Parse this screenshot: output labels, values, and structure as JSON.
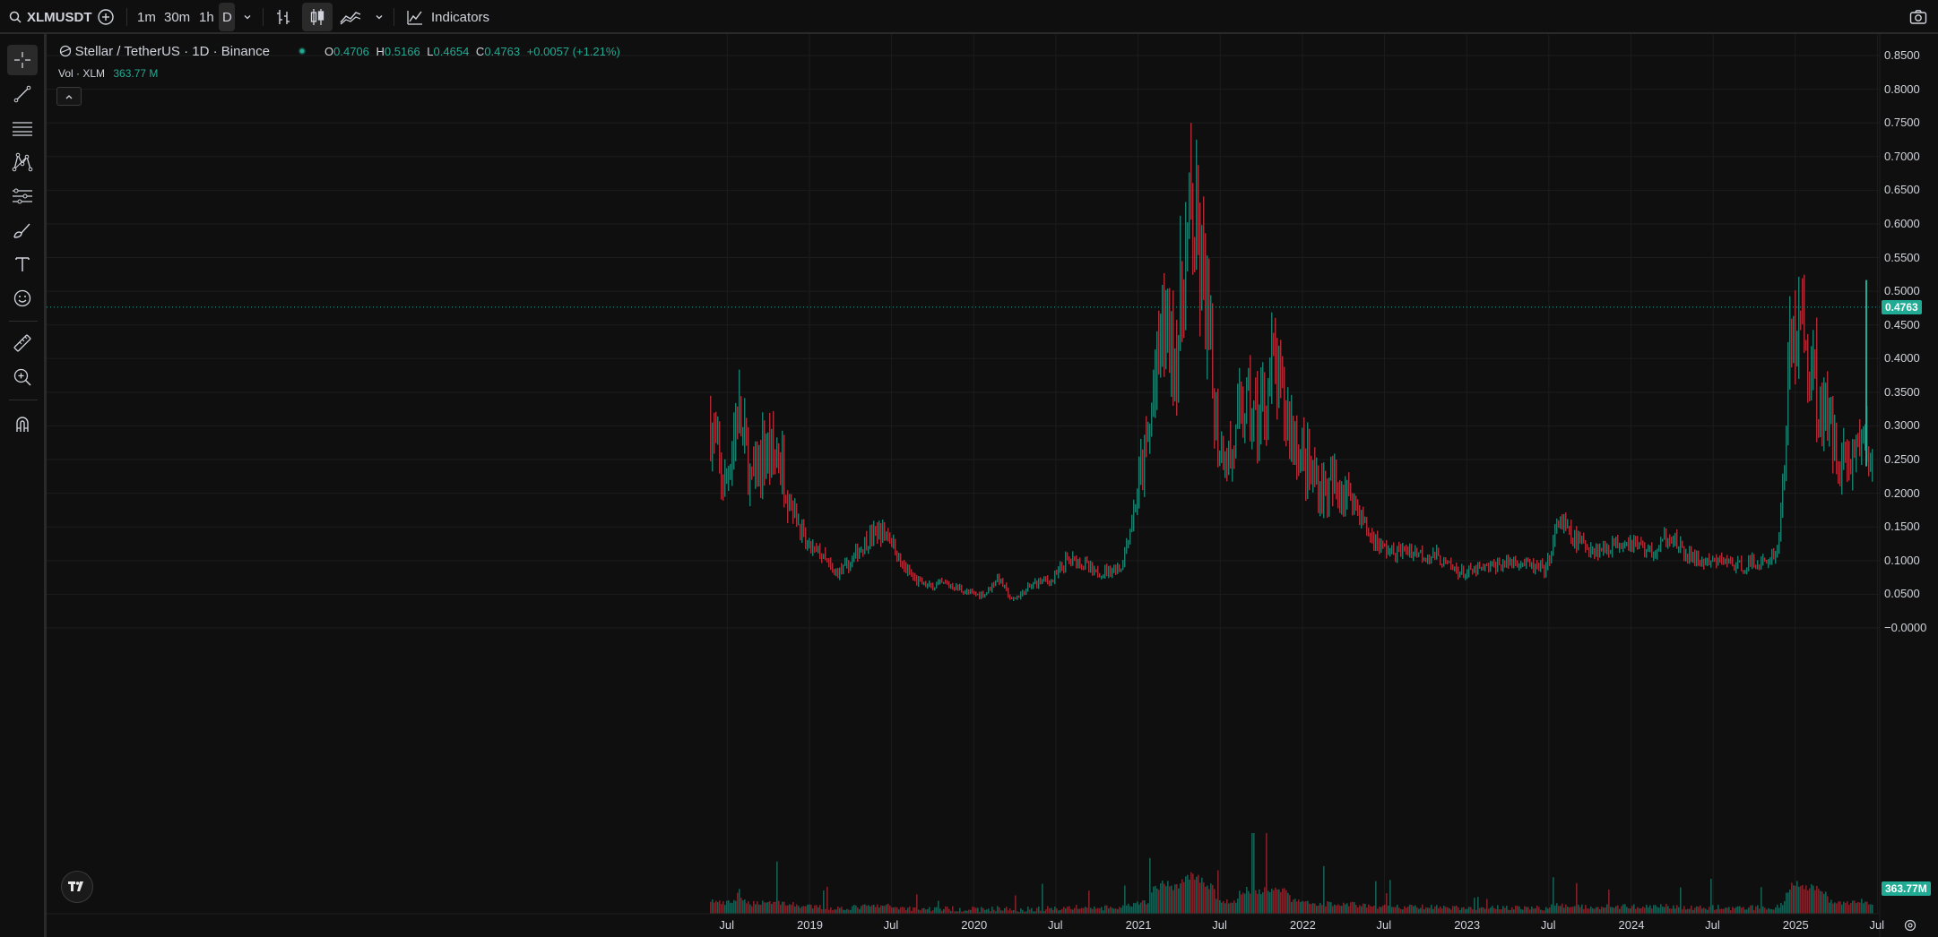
{
  "toolbar": {
    "symbol": "XLMUSDT",
    "intervals": [
      "1m",
      "30m",
      "1h",
      "D"
    ],
    "indicators_label": "Indicators"
  },
  "legend": {
    "title": "Stellar / TetherUS · 1D · Binance",
    "ohlc": [
      {
        "label": "O",
        "value": "0.4706"
      },
      {
        "label": "H",
        "value": "0.5166"
      },
      {
        "label": "L",
        "value": "0.4654"
      },
      {
        "label": "C",
        "value": "0.4763"
      }
    ],
    "change": "+0.0057 (+1.21%)",
    "volume_label": "Vol · XLM",
    "volume_value": "363.77 M",
    "status_color": "#22ab94"
  },
  "colors": {
    "up": "#22ab94",
    "down": "#f23645",
    "background": "#0f0f0f"
  },
  "price_axis": {
    "ticks": [
      "0.8500",
      "0.8000",
      "0.7500",
      "0.7000",
      "0.6500",
      "0.6000",
      "0.5500",
      "0.5000",
      "0.4500",
      "0.4000",
      "0.3500",
      "0.3000",
      "0.2500",
      "0.2000",
      "0.1500",
      "0.1000",
      "0.0500",
      "−0.0000"
    ],
    "last_price": "0.4763",
    "last_volume": "363.77M"
  },
  "time_axis": {
    "ticks": [
      "Jul",
      "2019",
      "Jul",
      "2020",
      "Jul",
      "2021",
      "Jul",
      "2022",
      "Jul",
      "2023",
      "Jul",
      "2024",
      "Jul",
      "2025",
      "Jul"
    ]
  },
  "chart_data": {
    "type": "candlestick",
    "interval": "1D",
    "x_range": [
      "2018-05",
      "2025-07"
    ],
    "ylim": [
      -0.02,
      0.87
    ],
    "grid": true,
    "last_close": 0.4763,
    "price_path": [
      [
        "2018-05",
        0.3
      ],
      [
        "2018-06",
        0.2
      ],
      [
        "2018-07",
        0.32
      ],
      [
        "2018-08",
        0.21
      ],
      [
        "2018-09",
        0.26
      ],
      [
        "2018-10",
        0.25
      ],
      [
        "2018-11",
        0.18
      ],
      [
        "2018-12",
        0.12
      ],
      [
        "2019-01",
        0.11
      ],
      [
        "2019-02",
        0.08
      ],
      [
        "2019-03",
        0.09
      ],
      [
        "2019-04",
        0.12
      ],
      [
        "2019-05",
        0.14
      ],
      [
        "2019-06",
        0.14
      ],
      [
        "2019-07",
        0.09
      ],
      [
        "2019-08",
        0.07
      ],
      [
        "2019-09",
        0.06
      ],
      [
        "2019-10",
        0.065
      ],
      [
        "2019-11",
        0.06
      ],
      [
        "2019-12",
        0.05
      ],
      [
        "2020-01",
        0.05
      ],
      [
        "2020-02",
        0.075
      ],
      [
        "2020-03",
        0.04
      ],
      [
        "2020-04",
        0.055
      ],
      [
        "2020-05",
        0.07
      ],
      [
        "2020-06",
        0.07
      ],
      [
        "2020-07",
        0.1
      ],
      [
        "2020-08",
        0.1
      ],
      [
        "2020-09",
        0.08
      ],
      [
        "2020-10",
        0.085
      ],
      [
        "2020-11",
        0.09
      ],
      [
        "2020-12",
        0.18
      ],
      [
        "2021-01",
        0.28
      ],
      [
        "2021-02",
        0.45
      ],
      [
        "2021-03",
        0.4
      ],
      [
        "2021-04",
        0.6
      ],
      [
        "2021-05",
        0.5
      ],
      [
        "2021-06",
        0.28
      ],
      [
        "2021-07",
        0.25
      ],
      [
        "2021-08",
        0.33
      ],
      [
        "2021-09",
        0.3
      ],
      [
        "2021-10",
        0.38
      ],
      [
        "2021-11",
        0.32
      ],
      [
        "2021-12",
        0.26
      ],
      [
        "2022-01",
        0.22
      ],
      [
        "2022-02",
        0.2
      ],
      [
        "2022-03",
        0.21
      ],
      [
        "2022-04",
        0.19
      ],
      [
        "2022-05",
        0.14
      ],
      [
        "2022-06",
        0.12
      ],
      [
        "2022-07",
        0.11
      ],
      [
        "2022-08",
        0.115
      ],
      [
        "2022-09",
        0.11
      ],
      [
        "2022-10",
        0.105
      ],
      [
        "2022-11",
        0.09
      ],
      [
        "2022-12",
        0.08
      ],
      [
        "2023-01",
        0.085
      ],
      [
        "2023-02",
        0.09
      ],
      [
        "2023-03",
        0.095
      ],
      [
        "2023-04",
        0.1
      ],
      [
        "2023-05",
        0.09
      ],
      [
        "2023-06",
        0.085
      ],
      [
        "2023-07",
        0.16
      ],
      [
        "2023-08",
        0.13
      ],
      [
        "2023-09",
        0.12
      ],
      [
        "2023-10",
        0.115
      ],
      [
        "2023-11",
        0.125
      ],
      [
        "2023-12",
        0.13
      ],
      [
        "2024-01",
        0.12
      ],
      [
        "2024-02",
        0.11
      ],
      [
        "2024-03",
        0.14
      ],
      [
        "2024-04",
        0.11
      ],
      [
        "2024-05",
        0.1
      ],
      [
        "2024-06",
        0.095
      ],
      [
        "2024-07",
        0.1
      ],
      [
        "2024-08",
        0.09
      ],
      [
        "2024-09",
        0.095
      ],
      [
        "2024-10",
        0.095
      ],
      [
        "2024-11",
        0.12
      ],
      [
        "2024-12",
        0.45
      ],
      [
        "2025-01",
        0.42
      ],
      [
        "2025-02",
        0.33
      ],
      [
        "2025-03",
        0.28
      ],
      [
        "2025-04",
        0.24
      ],
      [
        "2025-05",
        0.28
      ],
      [
        "2025-06",
        0.24
      ],
      [
        "2025-07",
        0.4763
      ]
    ],
    "ohlc_last": {
      "open": 0.4706,
      "high": 0.5166,
      "low": 0.4654,
      "close": 0.4763
    }
  }
}
